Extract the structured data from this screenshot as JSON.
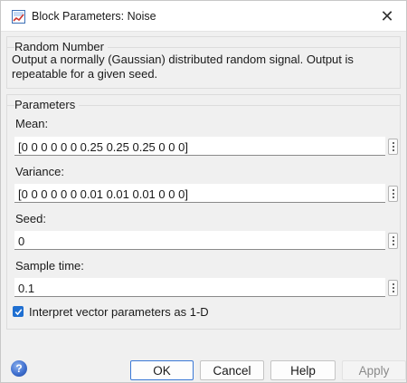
{
  "window": {
    "title": "Block Parameters: Noise",
    "close_glyph": "✕",
    "app_icon": "simulink-block-icon"
  },
  "block_group": {
    "title": "Random Number",
    "description": "Output a normally (Gaussian) distributed random signal.  Output is repeatable for a given seed."
  },
  "parameters": {
    "title": "Parameters",
    "fields": [
      {
        "label": "Mean:",
        "value": "[0 0 0 0 0 0 0.25 0.25 0.25 0 0 0]"
      },
      {
        "label": "Variance:",
        "value": "[0 0 0 0 0 0 0.01 0.01 0.01 0 0 0]"
      },
      {
        "label": "Seed:",
        "value": "0"
      },
      {
        "label": "Sample time:",
        "value": "0.1"
      }
    ],
    "checkbox": {
      "label": "Interpret vector parameters as 1-D",
      "checked": true
    }
  },
  "footer": {
    "help_icon_glyph": "?",
    "ok_label": "OK",
    "cancel_label": "Cancel",
    "help_label": "Help",
    "apply_label": "Apply"
  },
  "colors": {
    "accent": "#1f6fd1",
    "dialog_bg": "#f0f0f0"
  }
}
